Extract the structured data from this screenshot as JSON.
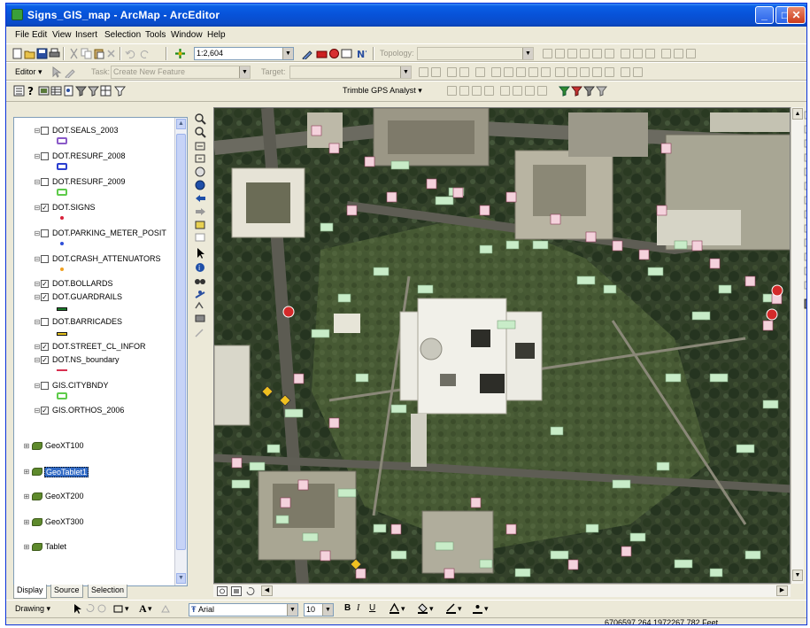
{
  "window": {
    "title": "Signs_GIS_map - ArcMap - ArcEditor"
  },
  "menu": [
    "File",
    "Edit",
    "View",
    "Insert",
    "Selection",
    "Tools",
    "Window",
    "Help"
  ],
  "standard_toolbar": {
    "scale": "1:2,604",
    "topology_label": "Topology:"
  },
  "editor_toolbar": {
    "editor_label": "Editor",
    "task_label": "Task:",
    "task_value": "Create New Feature",
    "target_label": "Target:"
  },
  "gps_toolbar": {
    "trimble_label": "Trimble GPS Analyst"
  },
  "toc": {
    "layers": [
      {
        "name": "DOT.SEALS_2003",
        "checked": false,
        "symbol": "box-purple"
      },
      {
        "name": "DOT.RESURF_2008",
        "checked": false,
        "symbol": "box-blue"
      },
      {
        "name": "DOT.RESURF_2009",
        "checked": false,
        "symbol": "box-green"
      },
      {
        "name": "DOT.SIGNS",
        "checked": true,
        "symbol": "dot-red"
      },
      {
        "name": "DOT.PARKING_METER_POSIT",
        "checked": false,
        "symbol": "dot-blue"
      },
      {
        "name": "DOT.CRASH_ATTENUATORS",
        "checked": false,
        "symbol": "dot-orange"
      },
      {
        "name": "DOT.BOLLARDS",
        "checked": true,
        "symbol": "none"
      },
      {
        "name": "DOT.GUARDRAILS",
        "checked": true,
        "symbol": "line-green"
      },
      {
        "name": "DOT.BARRICADES",
        "checked": false,
        "symbol": "line-yellow"
      },
      {
        "name": "DOT.STREET_CL_INFOR",
        "checked": true,
        "symbol": "none"
      },
      {
        "name": "DOT.NS_boundary",
        "checked": true,
        "symbol": "line-red"
      },
      {
        "name": "GIS.CITYBNDY",
        "checked": false,
        "symbol": "box-green"
      },
      {
        "name": "GIS.ORTHOS_2006",
        "checked": true,
        "symbol": "none"
      }
    ],
    "groups": [
      {
        "name": "GeoXT100",
        "selected": false
      },
      {
        "name": "GeoTablet1",
        "selected": true
      },
      {
        "name": "GeoXT200",
        "selected": false
      },
      {
        "name": "GeoXT300",
        "selected": false
      },
      {
        "name": "Tablet",
        "selected": false
      }
    ],
    "tabs": [
      "Display",
      "Source",
      "Selection"
    ]
  },
  "drawing_toolbar": {
    "drawing_label": "Drawing",
    "font": "Arial",
    "font_size": "10"
  },
  "status": {
    "coordinates": "6706597.264  1972267.782 Feet"
  },
  "colors": {
    "titlebar": "#0a5fe6",
    "selection": "#316ac5",
    "map_background": "#3a452c",
    "sign_label": "#c8ecc8",
    "sign_symbol": "#f4d2dc"
  }
}
